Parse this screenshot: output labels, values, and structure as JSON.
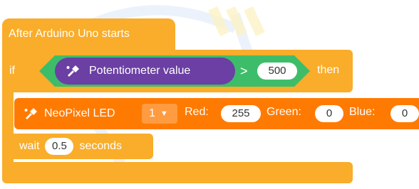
{
  "event": {
    "label": "After Arduino Uno starts"
  },
  "if_block": {
    "if_label": "if",
    "then_label": "then"
  },
  "condition": {
    "sensor_label": "Potentiometer value",
    "operator": ">",
    "value": "500"
  },
  "neopixel": {
    "label": "NeoPixel LED",
    "led_index": "1",
    "red_label": "Red:",
    "red_value": "255",
    "green_label": "Green:",
    "green_value": "0",
    "blue_label": "Blue:",
    "blue_value": "0"
  },
  "wait": {
    "label": "wait",
    "value": "0.5",
    "unit": "seconds"
  },
  "colors": {
    "control": "#f9ad2a",
    "sensor": "#6b3fa3",
    "operator": "#3dbd6a",
    "neopixel": "#ff7a00"
  },
  "icons": {
    "sensor_icon": "arduino-pen-icon",
    "neopixel_icon": "arduino-pen-icon"
  }
}
